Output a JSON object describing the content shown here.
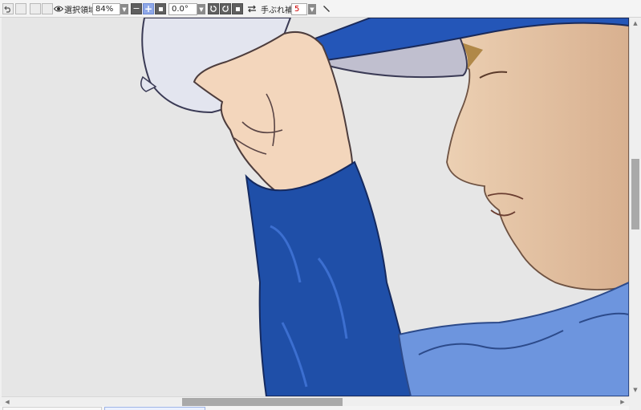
{
  "toolbar": {
    "undo_icon": "undo-icon",
    "eye_icon": "eye-icon",
    "selection_label": "選択領域",
    "zoom_value": "84%",
    "zoom_minus": "−",
    "zoom_plus": "+",
    "fit_icon": "square-icon",
    "rotation_value": "0.0°",
    "rotate_ccw_icon": "rotate-ccw-icon",
    "rotate_cw_icon": "rotate-cw-icon",
    "reset_icon": "square-icon",
    "flip_icon": "flip-horizontal-icon",
    "stabilizer_label": "手ぶれ補正",
    "stabilizer_value": "5",
    "pen_icon": "pen-line-icon",
    "stabilizer_value_color": "#d00000",
    "accent_color": "#8fa8e8"
  },
  "canvas": {
    "background_color": "#e6e6e6",
    "illustration": "baseball player tipping blue cap"
  },
  "scrollbars": {
    "vertical_position": 0.46,
    "horizontal_position": 0.38
  }
}
